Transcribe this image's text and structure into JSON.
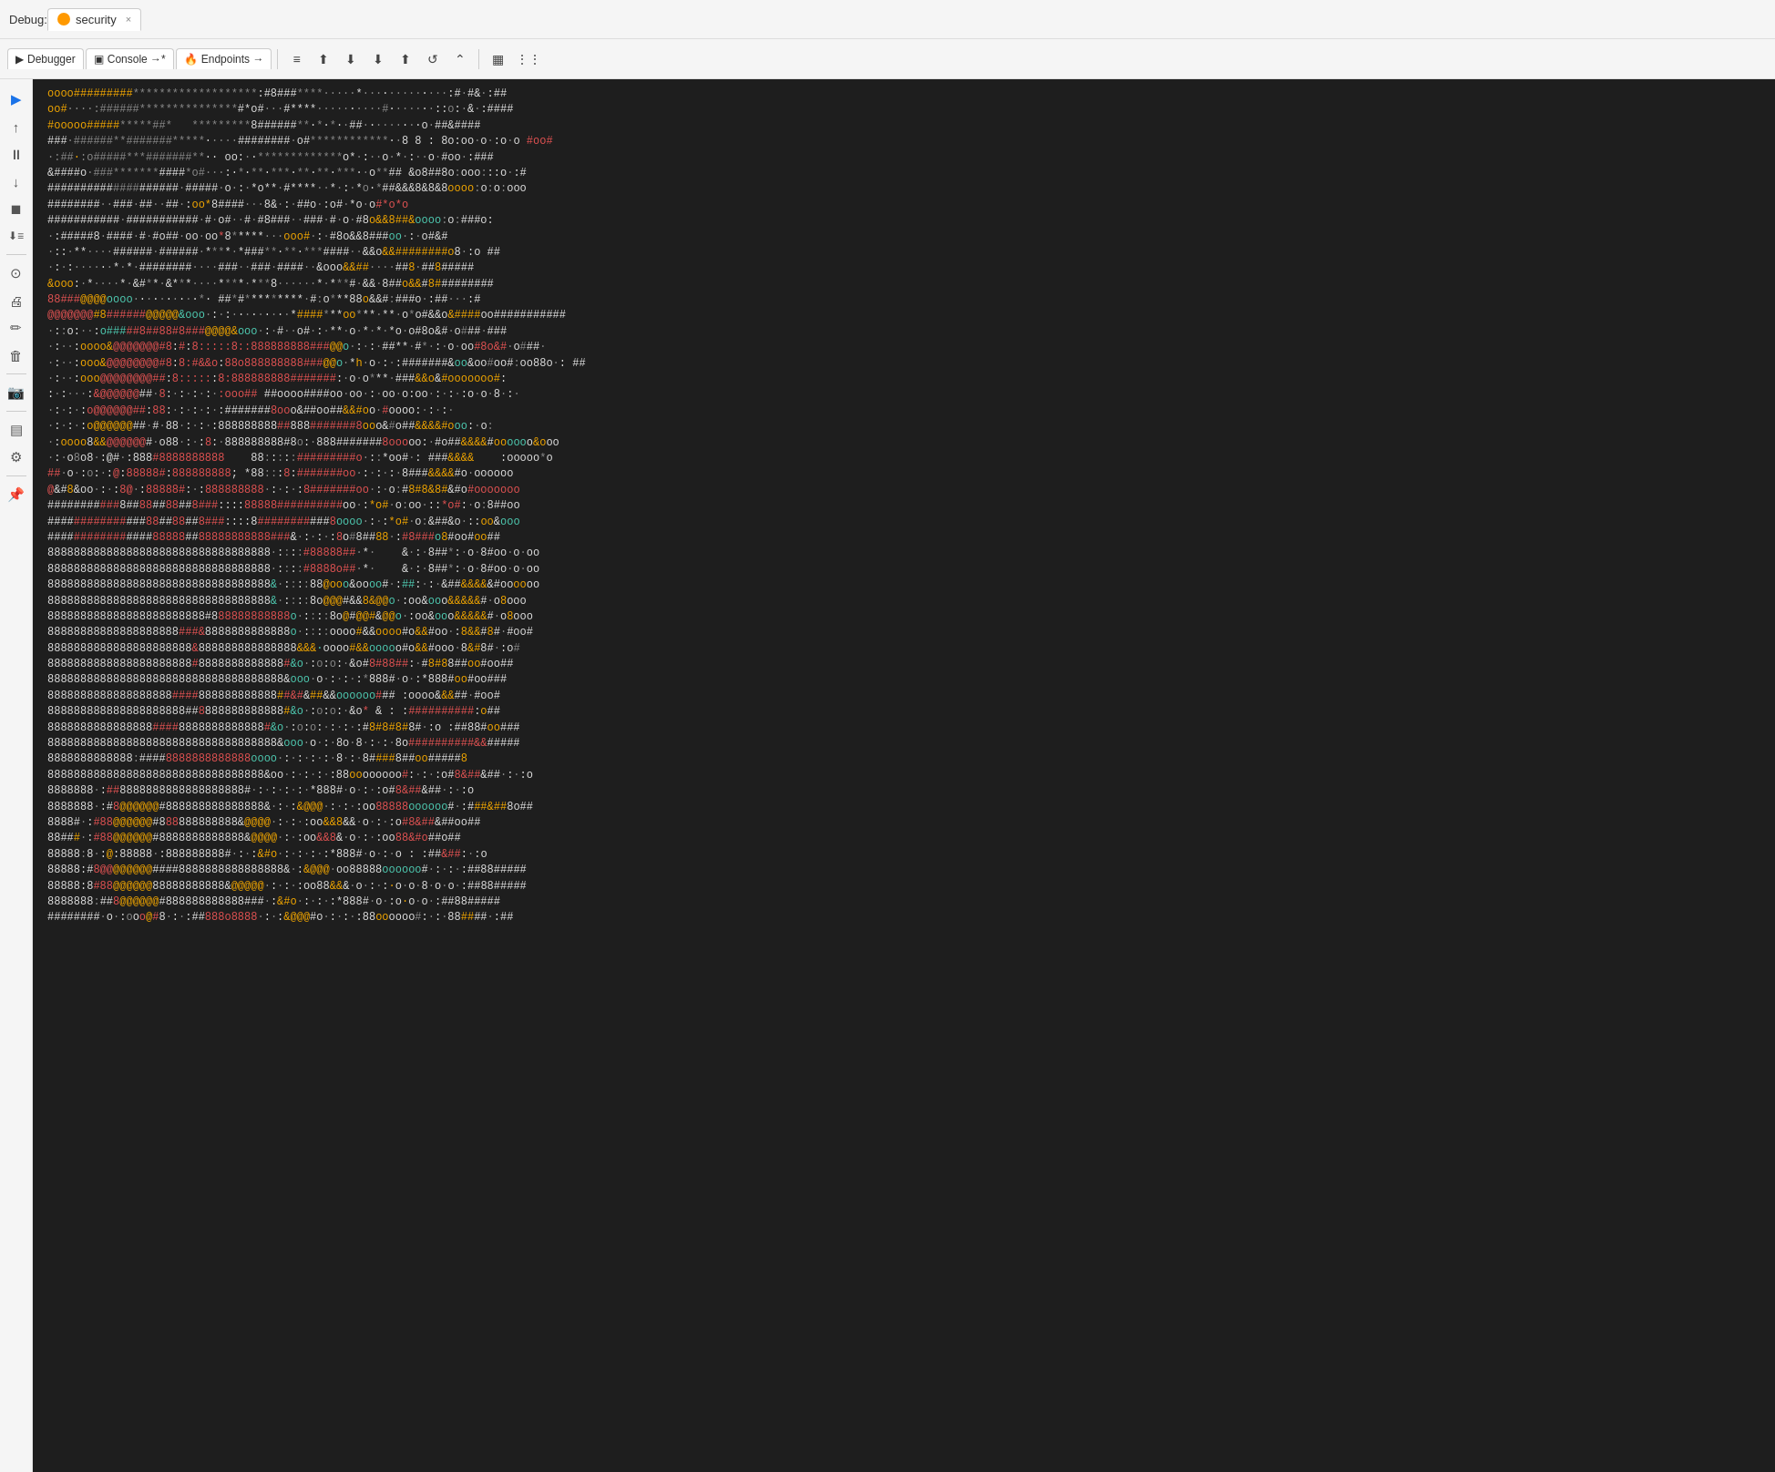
{
  "titlebar": {
    "debug_label": "Debug:",
    "tab_label": "security",
    "close_label": "×"
  },
  "toolbar": {
    "tabs": [
      {
        "label": "Debugger",
        "icon": "▶",
        "active": false
      },
      {
        "label": "Console",
        "icon": "▣",
        "active": true,
        "suffix": "→*"
      },
      {
        "label": "Endpoints",
        "icon": "🔥",
        "active": false,
        "suffix": "→"
      }
    ],
    "buttons": [
      "≡",
      "⬆",
      "⬇",
      "⬇",
      "⬆",
      "↺",
      "⌃",
      "▦",
      "⋮⋮"
    ]
  },
  "sidebar": {
    "buttons": [
      {
        "icon": "▶",
        "name": "play",
        "active": false
      },
      {
        "icon": "↑",
        "name": "step-over-up"
      },
      {
        "icon": "⏸",
        "name": "pause"
      },
      {
        "icon": "↓",
        "name": "step-over-down"
      },
      {
        "icon": "⏹",
        "name": "stop"
      },
      {
        "icon": "≡↓",
        "name": "step-into"
      },
      {
        "sep": true
      },
      {
        "icon": "⊙",
        "name": "breakpoints"
      },
      {
        "icon": "🖨",
        "name": "print"
      },
      {
        "icon": "✏",
        "name": "edit"
      },
      {
        "icon": "🗑",
        "name": "delete"
      },
      {
        "sep": true
      },
      {
        "icon": "📷",
        "name": "screenshot"
      },
      {
        "sep": true
      },
      {
        "icon": "▤",
        "name": "layout"
      },
      {
        "icon": "⚙",
        "name": "settings"
      },
      {
        "sep": true
      },
      {
        "icon": "📌",
        "name": "pin"
      }
    ]
  },
  "console": {
    "lines": []
  }
}
